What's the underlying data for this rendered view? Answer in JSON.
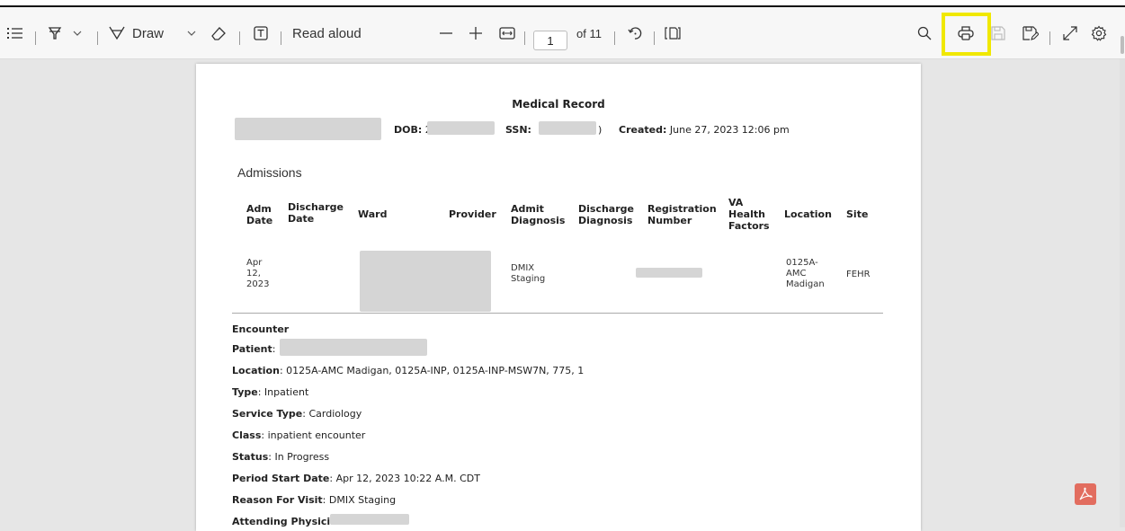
{
  "toolbar": {
    "draw_label": "Draw",
    "read_aloud_label": "Read aloud",
    "page_current": "1",
    "page_total": "of 11"
  },
  "document": {
    "title": "Medical Record",
    "dob_label": "DOB:",
    "dob_value": "2",
    "ssn_label": "SSN:",
    "ssn_tail": ")",
    "created_label": "Created:",
    "created_value": "June 27, 2023 12:06 pm",
    "admissions_heading": "Admissions",
    "table": {
      "headers": {
        "adm_date": [
          "Adm",
          "Date"
        ],
        "discharge_date": [
          "Discharge",
          "Date"
        ],
        "ward": "Ward",
        "provider": "Provider",
        "admit_diagnosis": [
          "Admit",
          "Diagnosis"
        ],
        "discharge_diagnosis": [
          "Discharge",
          "Diagnosis"
        ],
        "registration_number": [
          "Registration",
          "Number"
        ],
        "va_health_factors": [
          "VA",
          "Health",
          "Factors"
        ],
        "location": "Location",
        "site": "Site"
      },
      "row": {
        "adm_date": [
          "Apr",
          "12,",
          "2023"
        ],
        "admit_diagnosis": [
          "DMIX",
          "Staging"
        ],
        "location": [
          "0125A-",
          "AMC",
          "Madigan"
        ],
        "site": "FEHR"
      }
    },
    "encounter": {
      "heading": "Encounter",
      "patient_label": "Patient",
      "location_label": "Location",
      "location_value": "0125A-AMC Madigan, 0125A-INP, 0125A-INP-MSW7N, 775, 1",
      "type_label": "Type",
      "type_value": "Inpatient",
      "service_type_label": "Service Type",
      "service_type_value": "Cardiology",
      "class_label": "Class",
      "class_value": "inpatient encounter",
      "status_label": "Status",
      "status_value": "In Progress",
      "period_start_label": "Period Start Date",
      "period_start_value": "Apr 12, 2023 10:22 A.M. CDT",
      "reason_label": "Reason For Visit",
      "reason_value": "DMIX Staging",
      "attending_label": "Attending Physician"
    }
  },
  "colors": {
    "highlight": "#f0e800",
    "toolbar_bg": "#f7f7f7",
    "viewer_bg": "#e6e6e6",
    "pdf_badge": "#e26d5f"
  }
}
